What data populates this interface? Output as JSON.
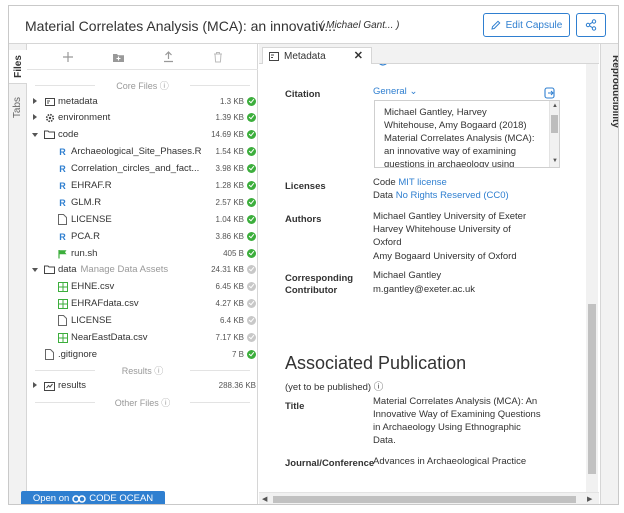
{
  "header": {
    "title": "Material Correlates Analysis (MCA): an innovativ...",
    "authors": "( Michael Gant... )",
    "edit_label": "Edit Capsule"
  },
  "side_tabs": {
    "files": "Files",
    "tabs": "Tabs",
    "reproducibility": "Reproducibility"
  },
  "files": {
    "core_label": "Core Files",
    "results_label": "Results",
    "other_label": "Other Files",
    "core": [
      {
        "name": "metadata",
        "size": "1.3 KB"
      },
      {
        "name": "environment",
        "size": "1.39 KB"
      },
      {
        "name": "code",
        "size": "14.69 KB"
      },
      {
        "name": "Archaeological_Site_Phases.R",
        "size": "1.54 KB"
      },
      {
        "name": "Correlation_circles_and_fact...",
        "size": "3.98 KB"
      },
      {
        "name": "EHRAF.R",
        "size": "1.28 KB"
      },
      {
        "name": "GLM.R",
        "size": "2.57 KB"
      },
      {
        "name": "LICENSE",
        "size": "1.04 KB"
      },
      {
        "name": "PCA.R",
        "size": "3.86 KB"
      },
      {
        "name": "run.sh",
        "size": "405 B"
      },
      {
        "name": "data",
        "size": "24.31 KB",
        "extra": "Manage Data Assets"
      },
      {
        "name": "EHNE.csv",
        "size": "6.45 KB"
      },
      {
        "name": "EHRAFdata.csv",
        "size": "4.27 KB"
      },
      {
        "name": "LICENSE",
        "size": "6.4 KB"
      },
      {
        "name": "NearEastData.csv",
        "size": "7.17 KB"
      },
      {
        "name": ".gitignore",
        "size": "7 B"
      }
    ],
    "results": {
      "name": "results",
      "size": "288.36 KB"
    },
    "open_label": "Open on",
    "brand": "CODE OCEAN"
  },
  "metadata": {
    "tab_label": "Metadata",
    "citation_label": "Citation",
    "citation_style": "General",
    "citation_text": "Michael Gantley, Harvey\nWhitehouse, Amy Bogaard (2018)\nMaterial Correlates Analysis (MCA):\nan innovative way of examining\nquestions in archaeology using",
    "licenses_label": "Licenses",
    "code_prefix": "Code",
    "code_license": "MIT license",
    "data_prefix": "Data",
    "data_license": "No Rights Reserved (CC0)",
    "authors_label": "Authors",
    "authors": [
      "Michael Gantley University of Exeter",
      "Harvey Whitehouse University of",
      "Oxford",
      "Amy Bogaard University of Oxford"
    ],
    "contributor_label_1": "Corresponding",
    "contributor_label_2": "Contributor",
    "contributor_name": "Michael Gantley",
    "contributor_email": "m.gantley@exeter.ac.uk",
    "publication_heading": "Associated Publication",
    "publication_status": "(yet to be published)",
    "title_label": "Title",
    "title_lines": [
      "Material Correlates Analysis (MCA): An",
      "Innovative Way of Examining Questions",
      "in Archaeology Using Ethnographic",
      "Data."
    ],
    "journal_label": "Journal/Conference",
    "journal": "Advances in Archaeological Practice"
  }
}
